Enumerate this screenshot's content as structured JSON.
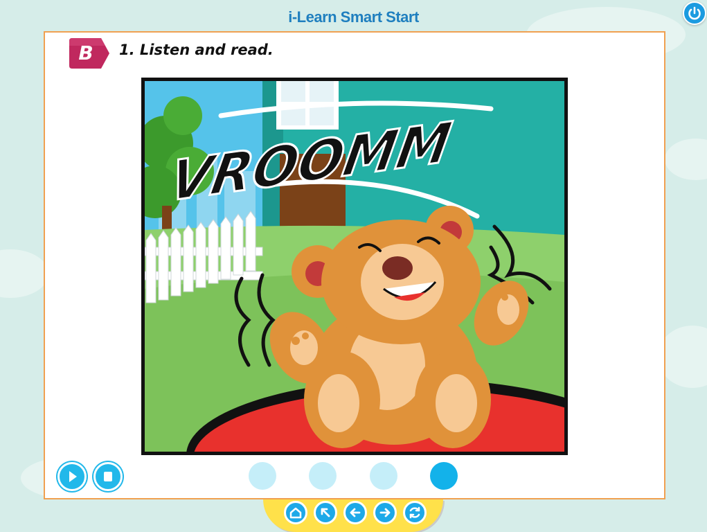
{
  "app": {
    "title": "i-Learn Smart Start"
  },
  "section": {
    "badge": "B",
    "instruction": "1. Listen and read."
  },
  "illustration": {
    "sound_effect": "VROOMM"
  },
  "icons": {
    "power": "power-icon",
    "play": "play-icon",
    "stop": "stop-icon",
    "home": "home-icon",
    "back_arrow": "arrow-up-left-icon",
    "previous": "arrow-left-icon",
    "next": "arrow-right-icon",
    "refresh": "refresh-icon"
  },
  "pagination": {
    "total": 4,
    "active_index": 4
  },
  "colors": {
    "accent": "#22b8ea",
    "badge": "#c0285e",
    "panel_border": "#f0a050",
    "nav_bar": "#ffe14a",
    "title": "#1f7fbf"
  }
}
